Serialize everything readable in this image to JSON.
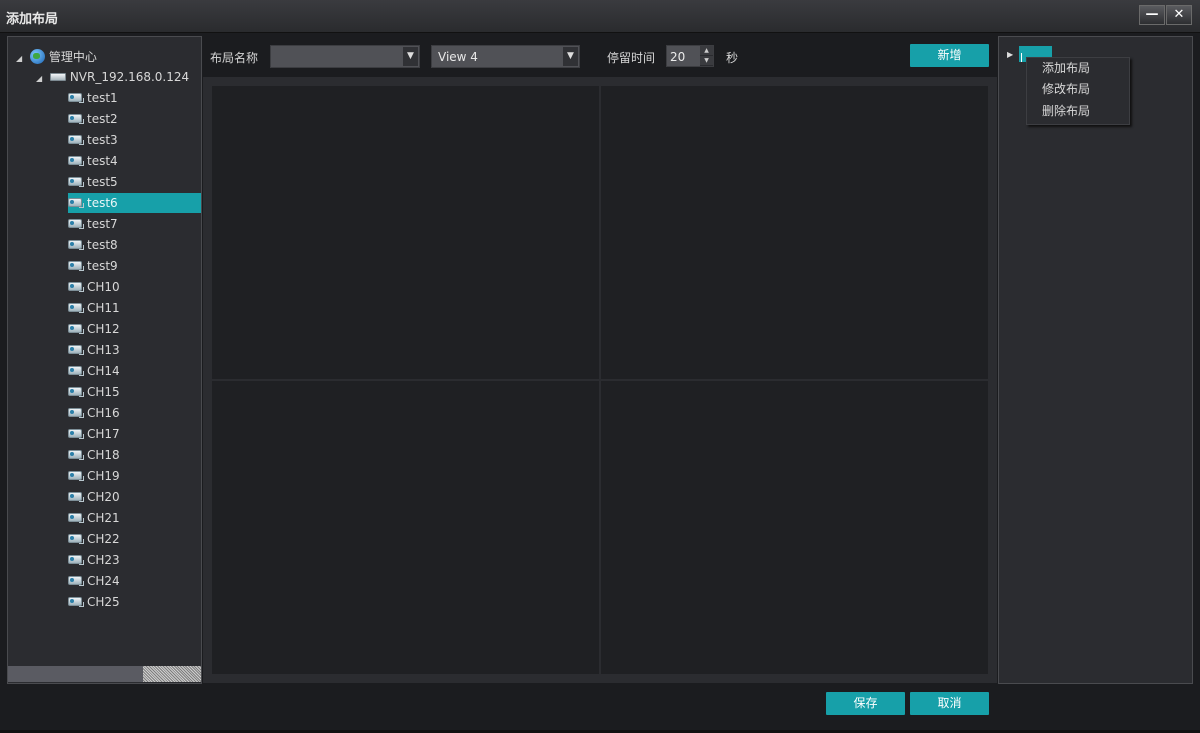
{
  "window": {
    "title": "添加布局",
    "minimize_glyph": "—",
    "close_glyph": "✕"
  },
  "tree": {
    "root_label": "管理中心",
    "nvr_label": "NVR_192.168.0.124",
    "channels": [
      "test1",
      "test2",
      "test3",
      "test4",
      "test5",
      "test6",
      "test7",
      "test8",
      "test9",
      "CH10",
      "CH11",
      "CH12",
      "CH13",
      "CH14",
      "CH15",
      "CH16",
      "CH17",
      "CH18",
      "CH19",
      "CH20",
      "CH21",
      "CH22",
      "CH23",
      "CH24",
      "CH25"
    ],
    "selected": "test6"
  },
  "toolbar": {
    "layout_name_label": "布局名称",
    "layout_name_value": "",
    "view_value": "View 4",
    "dwell_label": "停留时间",
    "dwell_value": "20",
    "dwell_unit": "秒",
    "new_button": "新增"
  },
  "context_menu": {
    "items": [
      "添加布局",
      "修改布局",
      "删除布局"
    ]
  },
  "footer": {
    "save_button": "保存",
    "cancel_button": "取消"
  },
  "colors": {
    "accent": "#17a0a9",
    "background": "#1b1c1f",
    "panel": "#2b2c30"
  }
}
